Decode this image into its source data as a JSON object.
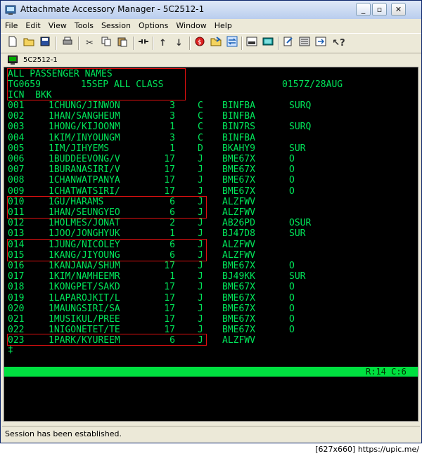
{
  "window": {
    "title": "Attachmate Accessory Manager - 5C2512-1"
  },
  "menu": [
    "File",
    "Edit",
    "View",
    "Tools",
    "Session",
    "Options",
    "Window",
    "Help"
  ],
  "session": {
    "tab_name": "5C2512-1"
  },
  "header": {
    "line1": "ALL PASSENGER NAMES",
    "flight": "TG0659",
    "date_class": "15SEP ALL CLASS",
    "timestamp": "0157Z/28AUG",
    "route": "ICN  BKK"
  },
  "passengers": [
    {
      "no": "001",
      "name": "1CHUNG/JINWON",
      "qty": "3",
      "cls": "C",
      "pnr": "BINFBA",
      "remark": "SURQ"
    },
    {
      "no": "002",
      "name": "1HAN/SANGHEUM",
      "qty": "3",
      "cls": "C",
      "pnr": "BINFBA",
      "remark": ""
    },
    {
      "no": "003",
      "name": "1HONG/KIJOONM",
      "qty": "1",
      "cls": "C",
      "pnr": "BIN7RS",
      "remark": "SURQ"
    },
    {
      "no": "004",
      "name": "1KIM/INYOUNGM",
      "qty": "3",
      "cls": "C",
      "pnr": "BINFBA",
      "remark": ""
    },
    {
      "no": "005",
      "name": "1IM/JIHYEMS",
      "qty": "1",
      "cls": "D",
      "pnr": "BKAHY9",
      "remark": "SUR"
    },
    {
      "no": "006",
      "name": "1BUDDEEVONG/V",
      "qty": "17",
      "cls": "J",
      "pnr": "BME67X",
      "remark": "O"
    },
    {
      "no": "007",
      "name": "1BURANASIRI/V",
      "qty": "17",
      "cls": "J",
      "pnr": "BME67X",
      "remark": "O"
    },
    {
      "no": "008",
      "name": "1CHANWATPANYA",
      "qty": "17",
      "cls": "J",
      "pnr": "BME67X",
      "remark": "O"
    },
    {
      "no": "009",
      "name": "1CHATWATSIRI/",
      "qty": "17",
      "cls": "J",
      "pnr": "BME67X",
      "remark": "O"
    },
    {
      "no": "010",
      "name": "1GU/HARAMS",
      "qty": "6",
      "cls": "J",
      "pnr": "ALZFWV",
      "remark": ""
    },
    {
      "no": "011",
      "name": "1HAN/SEUNGYEO",
      "qty": "6",
      "cls": "J",
      "pnr": "ALZFWV",
      "remark": ""
    },
    {
      "no": "012",
      "name": "1HOLMES/JONAT",
      "qty": "2",
      "cls": "J",
      "pnr": "AB26PD",
      "remark": "OSUR"
    },
    {
      "no": "013",
      "name": "1JOO/JONGHYUK",
      "qty": "1",
      "cls": "J",
      "pnr": "BJ47D8",
      "remark": "SUR"
    },
    {
      "no": "014",
      "name": "1JUNG/NICOLEY",
      "qty": "6",
      "cls": "J",
      "pnr": "ALZFWV",
      "remark": ""
    },
    {
      "no": "015",
      "name": "1KANG/JIYOUNG",
      "qty": "6",
      "cls": "J",
      "pnr": "ALZFWV",
      "remark": ""
    },
    {
      "no": "016",
      "name": "1KANJANA/SHUM",
      "qty": "17",
      "cls": "J",
      "pnr": "BME67X",
      "remark": "O"
    },
    {
      "no": "017",
      "name": "1KIM/NAMHEEMR",
      "qty": "1",
      "cls": "J",
      "pnr": "BJ49KK",
      "remark": "SUR"
    },
    {
      "no": "018",
      "name": "1KONGPET/SAKD",
      "qty": "17",
      "cls": "J",
      "pnr": "BME67X",
      "remark": "O"
    },
    {
      "no": "019",
      "name": "1LAPAROJKIT/L",
      "qty": "17",
      "cls": "J",
      "pnr": "BME67X",
      "remark": "O"
    },
    {
      "no": "020",
      "name": "1MAUNGSIRI/SA",
      "qty": "17",
      "cls": "J",
      "pnr": "BME67X",
      "remark": "O"
    },
    {
      "no": "021",
      "name": "1MUSIKUL/PREE",
      "qty": "17",
      "cls": "J",
      "pnr": "BME67X",
      "remark": "O"
    },
    {
      "no": "022",
      "name": "1NIGONETET/TE",
      "qty": "17",
      "cls": "J",
      "pnr": "BME67X",
      "remark": "O"
    },
    {
      "no": "023",
      "name": "1PARK/KYUREEM",
      "qty": "6",
      "cls": "J",
      "pnr": "ALZFWV",
      "remark": ""
    }
  ],
  "prompt": "‡",
  "cursor_status": "R:14 C:6",
  "statusbar": {
    "text": "Session has been established."
  },
  "watermark": "[627x660] https://upic.me/",
  "colors": {
    "terminal_fg": "#00e65a",
    "terminal_bg": "#000000",
    "highlight_box": "#e01010",
    "status_row": "#00e040"
  },
  "toolbar_icons": [
    "new-icon",
    "open-icon",
    "save-icon",
    "print-icon",
    "cut-icon",
    "copy-icon",
    "paste-icon",
    "connect-icon",
    "up-arrow-icon",
    "down-arrow-icon",
    "record-icon",
    "transfer-icon",
    "transfer-swap-icon",
    "screen-icon",
    "keyboard-icon",
    "macro-icon",
    "display-icon",
    "help-icon"
  ]
}
